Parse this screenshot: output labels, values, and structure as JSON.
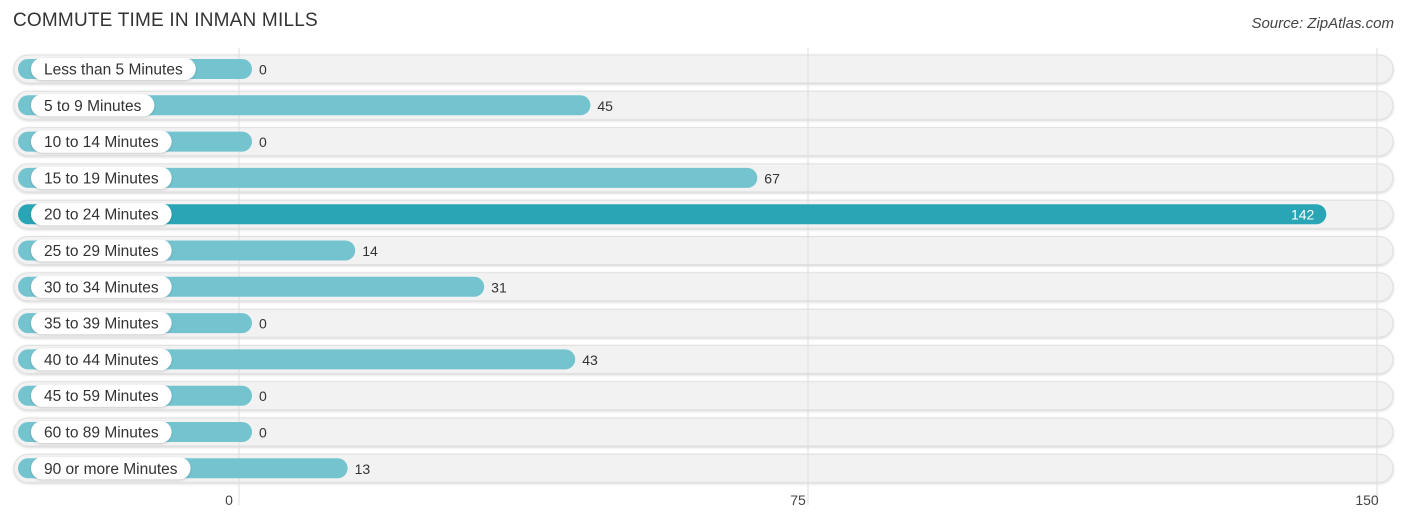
{
  "chart_data": {
    "type": "bar",
    "orientation": "horizontal",
    "title": "COMMUTE TIME IN INMAN MILLS",
    "source": "Source: ZipAtlas.com",
    "categories": [
      "Less than 5 Minutes",
      "5 to 9 Minutes",
      "10 to 14 Minutes",
      "15 to 19 Minutes",
      "20 to 24 Minutes",
      "25 to 29 Minutes",
      "30 to 34 Minutes",
      "35 to 39 Minutes",
      "40 to 44 Minutes",
      "45 to 59 Minutes",
      "60 to 89 Minutes",
      "90 or more Minutes"
    ],
    "values": [
      0,
      45,
      0,
      67,
      142,
      14,
      31,
      0,
      43,
      0,
      0,
      13
    ],
    "xlim": [
      0,
      150
    ],
    "xticks": [
      0,
      75,
      150
    ],
    "xtick_labels": [
      "0",
      "75",
      "150"
    ],
    "highlight_index": 4,
    "colors": {
      "bar": "#74c4d0",
      "highlight": "#2aa5b5",
      "track": "#f2f2f2"
    },
    "grid": true
  }
}
